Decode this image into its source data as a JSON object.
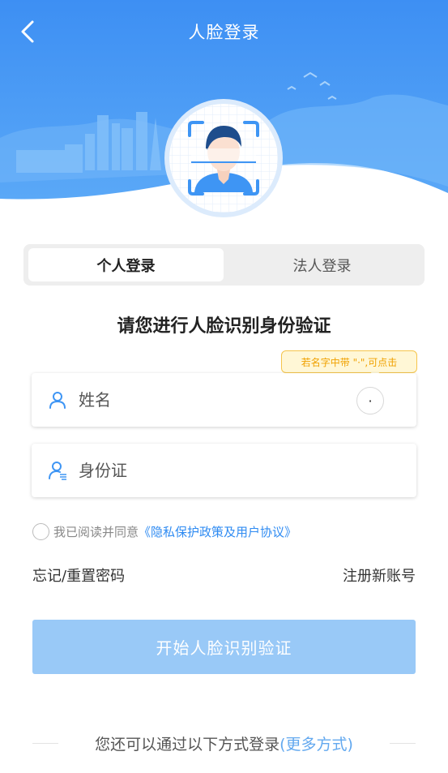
{
  "header": {
    "title": "人脸登录",
    "back_icon": "chevron-left-icon"
  },
  "tabs": [
    {
      "label": "个人登录",
      "active": true
    },
    {
      "label": "法人登录",
      "active": false
    }
  ],
  "heading": "请您进行人脸识别身份验证",
  "tooltip": "若名字中带 \"·\",可点击",
  "name_field": {
    "placeholder": "姓名",
    "value": "",
    "icon": "user-icon",
    "dot_label": "·"
  },
  "id_field": {
    "placeholder": "身份证",
    "value": "",
    "icon": "id-user-icon"
  },
  "agreement": {
    "prefix": "我已阅读并同意",
    "link": "《隐私保护政策及用户协议》",
    "checked": false
  },
  "links": {
    "forgot": "忘记/重置密码",
    "register": "注册新账号"
  },
  "start_button": "开始人脸识别验证",
  "alt_login": {
    "prefix": "您还可以通过以下方式登录",
    "more": "(更多方式)"
  },
  "colors": {
    "primary": "#3e95f4",
    "button": "#99c9f7",
    "link": "#2f8bf2",
    "tooltip_border": "#f5c54c"
  }
}
